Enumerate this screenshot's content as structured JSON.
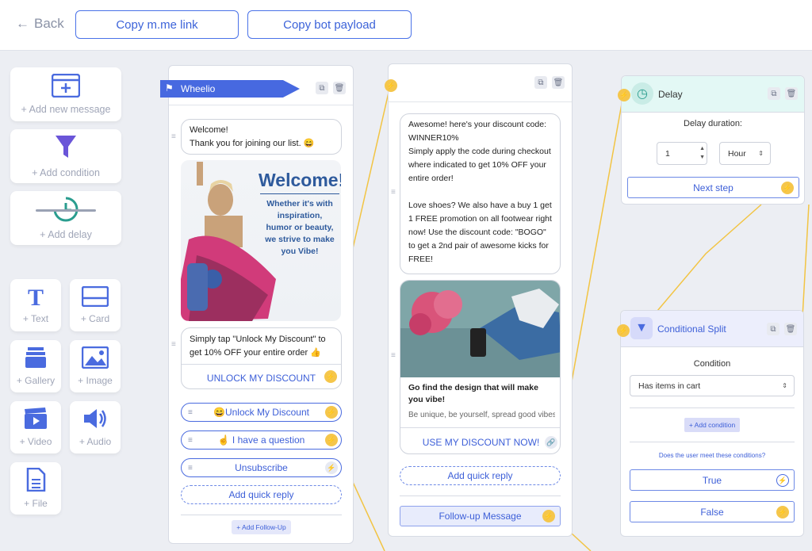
{
  "topbar": {
    "back_label": "Back",
    "copy_link_label": "Copy m.me link",
    "copy_payload_label": "Copy bot payload"
  },
  "tools": {
    "add_message": "+ Add new message",
    "add_condition": "+ Add condition",
    "add_delay": "+ Add delay",
    "text": "+ Text",
    "card": "+ Card",
    "gallery": "+ Gallery",
    "image": "+ Image",
    "video": "+ Video",
    "audio": "+ Audio",
    "file": "+ File"
  },
  "node1": {
    "flag_title": "Wheelio",
    "msg1_line1": "Welcome!",
    "msg1_line2": "Thank you for joining our list. 😄",
    "image_title": "Welcome!",
    "image_sub": "Whether it's with inspiration, humor or beauty, we strive to make you Vibe!",
    "msg2": "Simply tap \"Unlock My Discount\" to get 10% OFF your entire order 👍",
    "msg2_button": "UNLOCK MY DISCOUNT",
    "qr1": "😄Unlock My Discount",
    "qr2": "☝️ I have a question",
    "qr3": "Unsubscribe",
    "add_quick_reply": "Add quick reply",
    "add_follow_up": "+ Add Follow-Up"
  },
  "node2": {
    "msg_p1": "Awesome! here's your discount code: WINNER10%",
    "msg_p2": "Simply apply the code during checkout where indicated to get 10% OFF your entire order!",
    "msg_p3": "Love shoes? We also have a buy 1 get 1 FREE promotion on all footwear right now! Use the discount code: \"BOGO\" to get a 2nd pair of awesome kicks for FREE!",
    "card_title": "Go find the design that will make you vibe!",
    "card_subtitle": "Be unique, be yourself, spread good vibes...",
    "card_button": "USE MY DISCOUNT NOW!",
    "add_quick_reply": "Add quick reply",
    "follow_up": "Follow-up Message"
  },
  "delay": {
    "title": "Delay",
    "duration_label": "Delay duration:",
    "value": "1",
    "unit": "Hour",
    "next_step": "Next step"
  },
  "split": {
    "title": "Conditional Split",
    "condition_label": "Condition",
    "condition_value": "Has items in cart",
    "add_condition": "+ Add condition",
    "question": "Does the user meet these conditions?",
    "true_label": "True",
    "false_label": "False"
  },
  "colors": {
    "accent": "#4a6bdf",
    "bolt": "#f5c64b",
    "delay_header": "#e3f8f5",
    "split_header": "#eceefc"
  }
}
